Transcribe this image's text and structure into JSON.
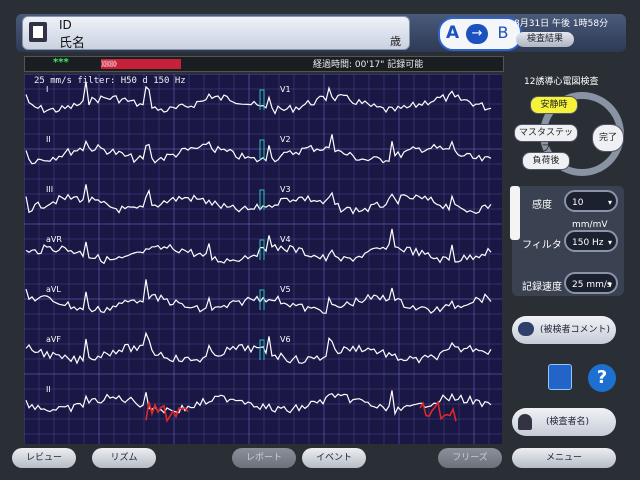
{
  "header": {
    "id_label": "ID",
    "name_label": "氏名",
    "age_label": "歳",
    "ab_a": "A",
    "ab_arrow": "→",
    "ab_b": "B",
    "datetime": "8月31日 午後 1時58分",
    "exam_result": "検査結果"
  },
  "status": {
    "dots": "***",
    "progress": "》》》》》》",
    "elapsed": "経過時間: 00'17\"  記録可能"
  },
  "ecg": {
    "filter": "25 mm/s filter: H50 d 150 Hz",
    "leads_left": [
      "I",
      "II",
      "III",
      "aVR",
      "aVL",
      "aVF",
      "II"
    ],
    "leads_right": [
      "V1",
      "V2",
      "V3",
      "V4",
      "V5",
      "V6"
    ]
  },
  "panel": {
    "title": "12誘導心電図検査",
    "steps": {
      "rest": "安静時",
      "master": "マスタステップ",
      "load": "負荷後",
      "done": "完了"
    },
    "sensitivity_label": "感度",
    "sensitivity_value": "10 mm/mV",
    "filter_label": "フィルタ",
    "filter_value": "150 Hz",
    "speed_label": "記録速度",
    "speed_value": "25 mm/s",
    "comment_button": "(被検者コメント)",
    "examiner_button": "(検査者名)"
  },
  "bottom": {
    "review": "レビュー",
    "rhythm": "リズム",
    "report": "レポート",
    "event": "イベント",
    "freeze": "フリーズ",
    "menu": "メニュー"
  },
  "colors": {
    "ecg_bg": "#1a1745",
    "grid": "#5a5ea8",
    "trace": "#ffffff",
    "highlight": "#e02828",
    "active_step": "#f6f23a"
  }
}
